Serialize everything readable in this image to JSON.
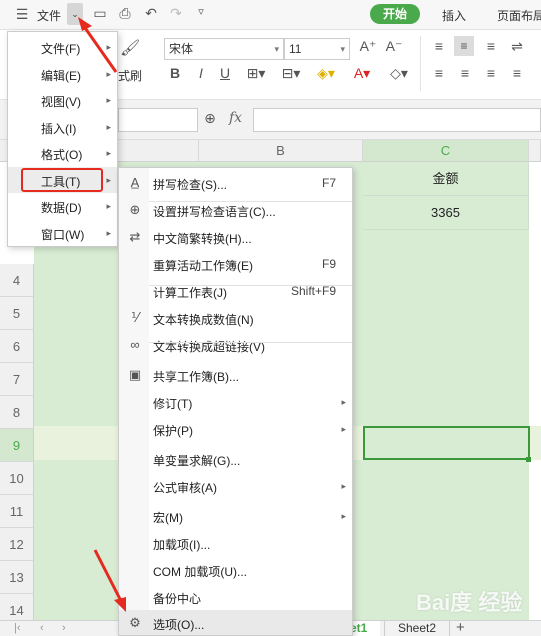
{
  "app": {
    "file_label": "文件",
    "tab_start": "开始",
    "tab_insert": "插入",
    "tab_layout": "页面布局",
    "font_name": "宋体",
    "font_size": "11",
    "brush_label": "式刷",
    "fx_label": "fx",
    "accent_green": "#4aa94a"
  },
  "main_menu": [
    {
      "label": "文件(F)",
      "name": "file"
    },
    {
      "label": "编辑(E)",
      "name": "edit"
    },
    {
      "label": "视图(V)",
      "name": "view"
    },
    {
      "label": "插入(I)",
      "name": "insert"
    },
    {
      "label": "格式(O)",
      "name": "format"
    },
    {
      "label": "工具(T)",
      "name": "tools"
    },
    {
      "label": "数据(D)",
      "name": "data"
    },
    {
      "label": "窗口(W)",
      "name": "window"
    }
  ],
  "tools_menu": [
    {
      "label": "拼写检查(S)...",
      "shortcut": "F7",
      "icon": "spell-check-icon"
    },
    {
      "label": "设置拼写检查语言(C)...",
      "shortcut": "",
      "icon": "language-icon"
    },
    {
      "label": "中文简繁转换(H)...",
      "shortcut": "",
      "icon": "convert-icon"
    },
    {
      "label": "重算活动工作簿(E)",
      "shortcut": "F9",
      "icon": ""
    },
    {
      "label": "计算工作表(J)",
      "shortcut": "Shift+F9",
      "icon": ""
    },
    {
      "label": "文本转换成数值(N)",
      "shortcut": "",
      "icon": "text-to-number-icon"
    },
    {
      "label": "文本转换成超链接(V)",
      "shortcut": "",
      "icon": "hyperlink-icon"
    },
    {
      "label": "共享工作簿(B)...",
      "shortcut": "",
      "icon": "share-workbook-icon"
    },
    {
      "label": "修订(T)",
      "shortcut": "",
      "icon": ""
    },
    {
      "label": "保护(P)",
      "shortcut": "",
      "icon": ""
    },
    {
      "label": "单变量求解(G)...",
      "shortcut": "",
      "icon": ""
    },
    {
      "label": "公式审核(A)",
      "shortcut": "",
      "icon": ""
    },
    {
      "label": "宏(M)",
      "shortcut": "",
      "icon": ""
    },
    {
      "label": "加载项(I)...",
      "shortcut": "",
      "icon": ""
    },
    {
      "label": "COM 加载项(U)...",
      "shortcut": "",
      "icon": ""
    },
    {
      "label": "备份中心",
      "shortcut": "",
      "icon": ""
    },
    {
      "label": "选项(O)...",
      "shortcut": "",
      "icon": "gear-icon"
    }
  ],
  "sheet": {
    "col_b": "B",
    "col_c": "C",
    "header_c": "金额",
    "value_c2": "3365",
    "rows": [
      "4",
      "5",
      "6",
      "7",
      "8",
      "9",
      "10",
      "11",
      "12",
      "13",
      "14"
    ]
  },
  "tabs": {
    "sheet1": "et1",
    "sheet2": "Sheet2",
    "add": "+"
  },
  "watermark": "Bai度 经验"
}
